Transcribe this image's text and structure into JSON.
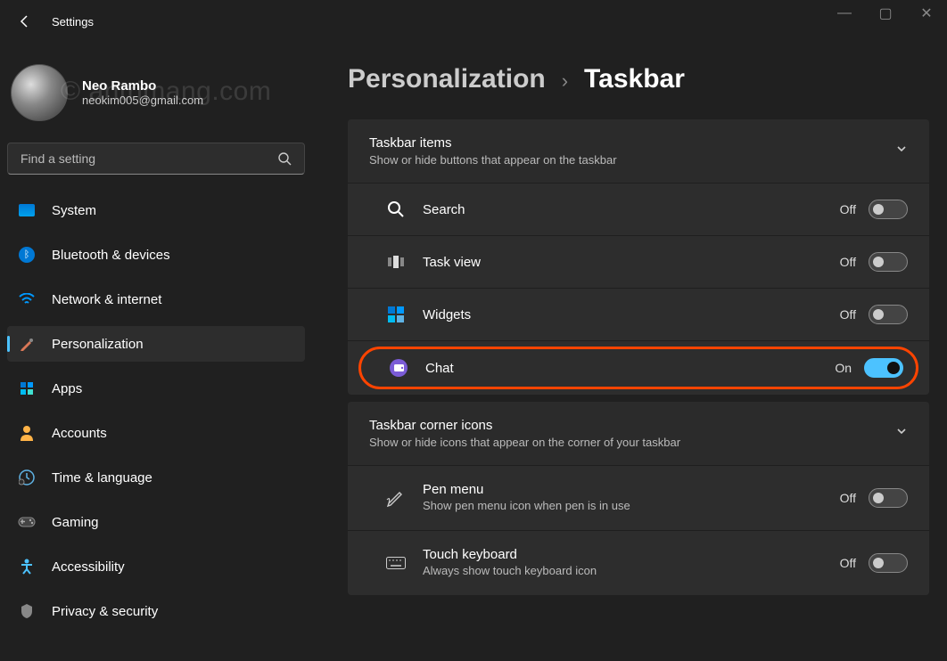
{
  "window": {
    "title": "Settings",
    "min": "—",
    "max": "▢",
    "close": "✕"
  },
  "profile": {
    "name": "Neo Rambo",
    "email": "neokim005@gmail.com",
    "watermark": "© antrimang.com"
  },
  "search": {
    "placeholder": "Find a setting"
  },
  "nav": [
    {
      "icon": "system",
      "label": "System"
    },
    {
      "icon": "bluetooth",
      "label": "Bluetooth & devices"
    },
    {
      "icon": "network",
      "label": "Network & internet"
    },
    {
      "icon": "personalization",
      "label": "Personalization"
    },
    {
      "icon": "apps",
      "label": "Apps"
    },
    {
      "icon": "accounts",
      "label": "Accounts"
    },
    {
      "icon": "time",
      "label": "Time & language"
    },
    {
      "icon": "gaming",
      "label": "Gaming"
    },
    {
      "icon": "accessibility",
      "label": "Accessibility"
    },
    {
      "icon": "privacy",
      "label": "Privacy & security"
    }
  ],
  "nav_active_index": 3,
  "breadcrumb": {
    "parent": "Personalization",
    "current": "Taskbar"
  },
  "sections": [
    {
      "title": "Taskbar items",
      "subtitle": "Show or hide buttons that appear on the taskbar",
      "rows": [
        {
          "icon": "search",
          "title": "Search",
          "state": "Off",
          "on": false
        },
        {
          "icon": "taskview",
          "title": "Task view",
          "state": "Off",
          "on": false
        },
        {
          "icon": "widgets",
          "title": "Widgets",
          "state": "Off",
          "on": false
        },
        {
          "icon": "chat",
          "title": "Chat",
          "state": "On",
          "on": true,
          "highlight": true
        }
      ]
    },
    {
      "title": "Taskbar corner icons",
      "subtitle": "Show or hide icons that appear on the corner of your taskbar",
      "rows": [
        {
          "icon": "pen",
          "title": "Pen menu",
          "desc": "Show pen menu icon when pen is in use",
          "state": "Off",
          "on": false
        },
        {
          "icon": "keyboard",
          "title": "Touch keyboard",
          "desc": "Always show touch keyboard icon",
          "state": "Off",
          "on": false
        }
      ]
    }
  ]
}
